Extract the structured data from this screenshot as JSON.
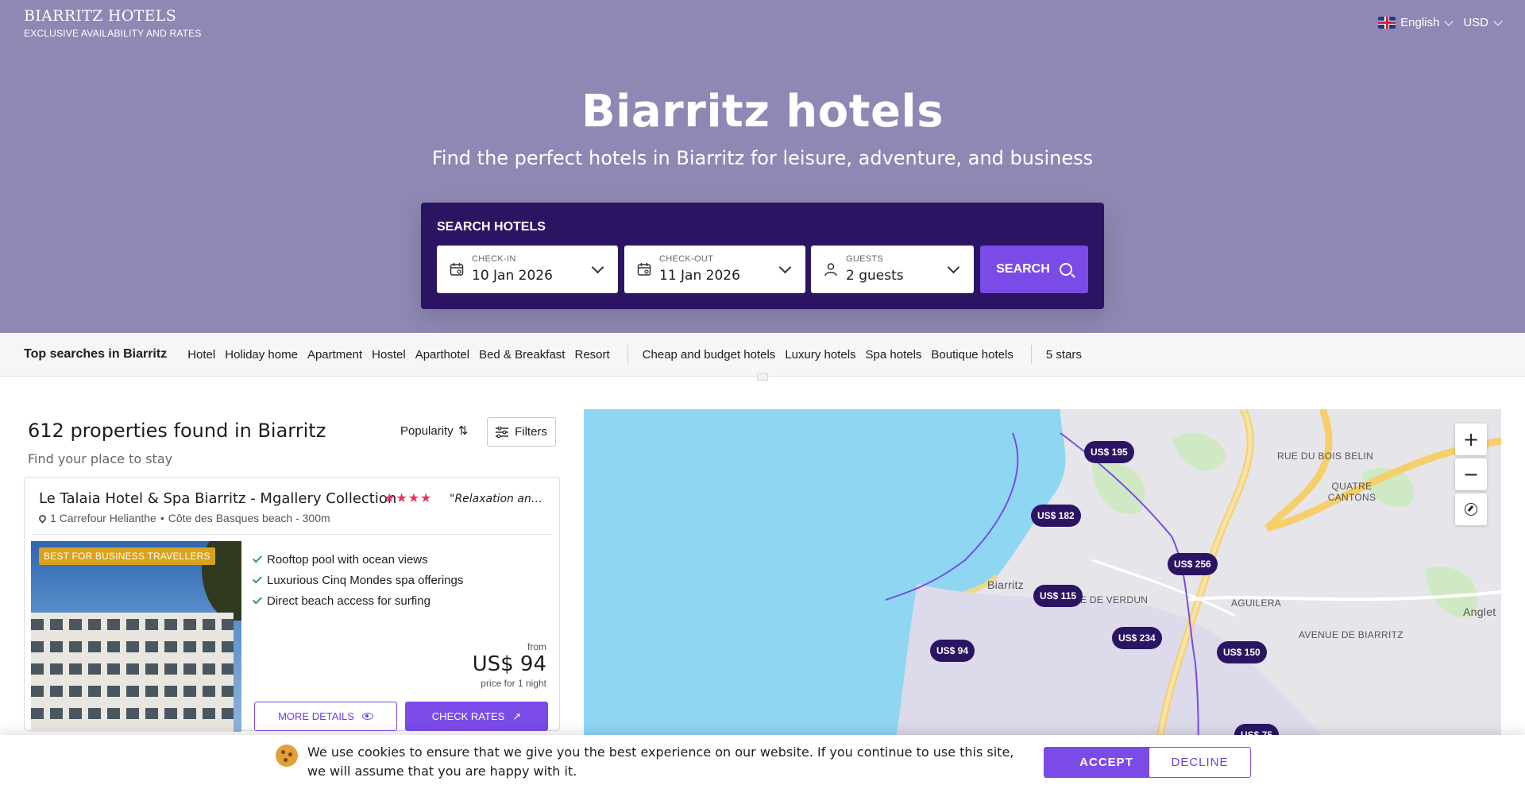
{
  "header": {
    "brand_name": "BIARRITZ HOTELS",
    "brand_tagline": "EXCLUSIVE AVAILABILITY AND RATES",
    "language": "English",
    "currency": "USD"
  },
  "hero": {
    "title": "Biarritz hotels",
    "subtitle": "Find the perfect hotels in Biarritz for leisure, adventure, and business"
  },
  "search": {
    "label": "SEARCH HOTELS",
    "checkin_label": "CHECK-IN",
    "checkin_value": "10 Jan 2026",
    "checkout_label": "CHECK-OUT",
    "checkout_value": "11 Jan 2026",
    "guests_label": "GUESTS",
    "guests_value": "2 guests",
    "button_label": "SEARCH"
  },
  "top_searches": {
    "title": "Top searches in Biarritz",
    "group1": [
      "Hotel",
      "Holiday home",
      "Apartment",
      "Hostel",
      "Aparthotel",
      "Bed & Breakfast",
      "Resort"
    ],
    "group2": [
      "Cheap and budget hotels",
      "Luxury hotels",
      "Spa hotels",
      "Boutique hotels"
    ],
    "group3": [
      "5 stars"
    ]
  },
  "results": {
    "title": "612 properties found in Biarritz",
    "subtitle": "Find your place to stay",
    "sort_label": "Popularity",
    "filters_label": "Filters"
  },
  "card": {
    "name": "Le Talaia Hotel & Spa Biarritz - Mgallery Collection",
    "stars": "★★★★",
    "quote": "\"Relaxation and ...",
    "address": "1 Carrefour Helianthe",
    "distance": "Côte des Basques beach - 300m",
    "badge": "BEST FOR BUSINESS TRAVELLERS",
    "features": [
      "Rooftop pool with ocean views",
      "Luxurious Cinq Mondes spa offerings",
      "Direct beach access for surfing"
    ],
    "from_label": "from",
    "price": "US$ 94",
    "price_note": "price for 1 night",
    "more_details_label": "MORE DETAILS",
    "check_rates_label": "CHECK RATES"
  },
  "map": {
    "pins": [
      "US$ 195",
      "US$ 182",
      "US$ 256",
      "US$ 115",
      "US$ 234",
      "US$ 94",
      "US$ 150",
      "US$ 75"
    ],
    "labels": [
      "RUE DU BOIS BELIN",
      "QUATRE CANTONS",
      "Biarritz",
      "AVENUE DE VERDUN",
      "AGUILERA",
      "AVENUE DE BIARRITZ",
      "Anglet"
    ],
    "zoom_in": "+",
    "zoom_out": "−"
  },
  "cookie": {
    "text": "We use cookies to ensure that we give you the best experience on our website. If you continue to use this site, we will assume that you are happy with it.",
    "accept_label": "ACCEPT",
    "decline_label": "DECLINE"
  }
}
